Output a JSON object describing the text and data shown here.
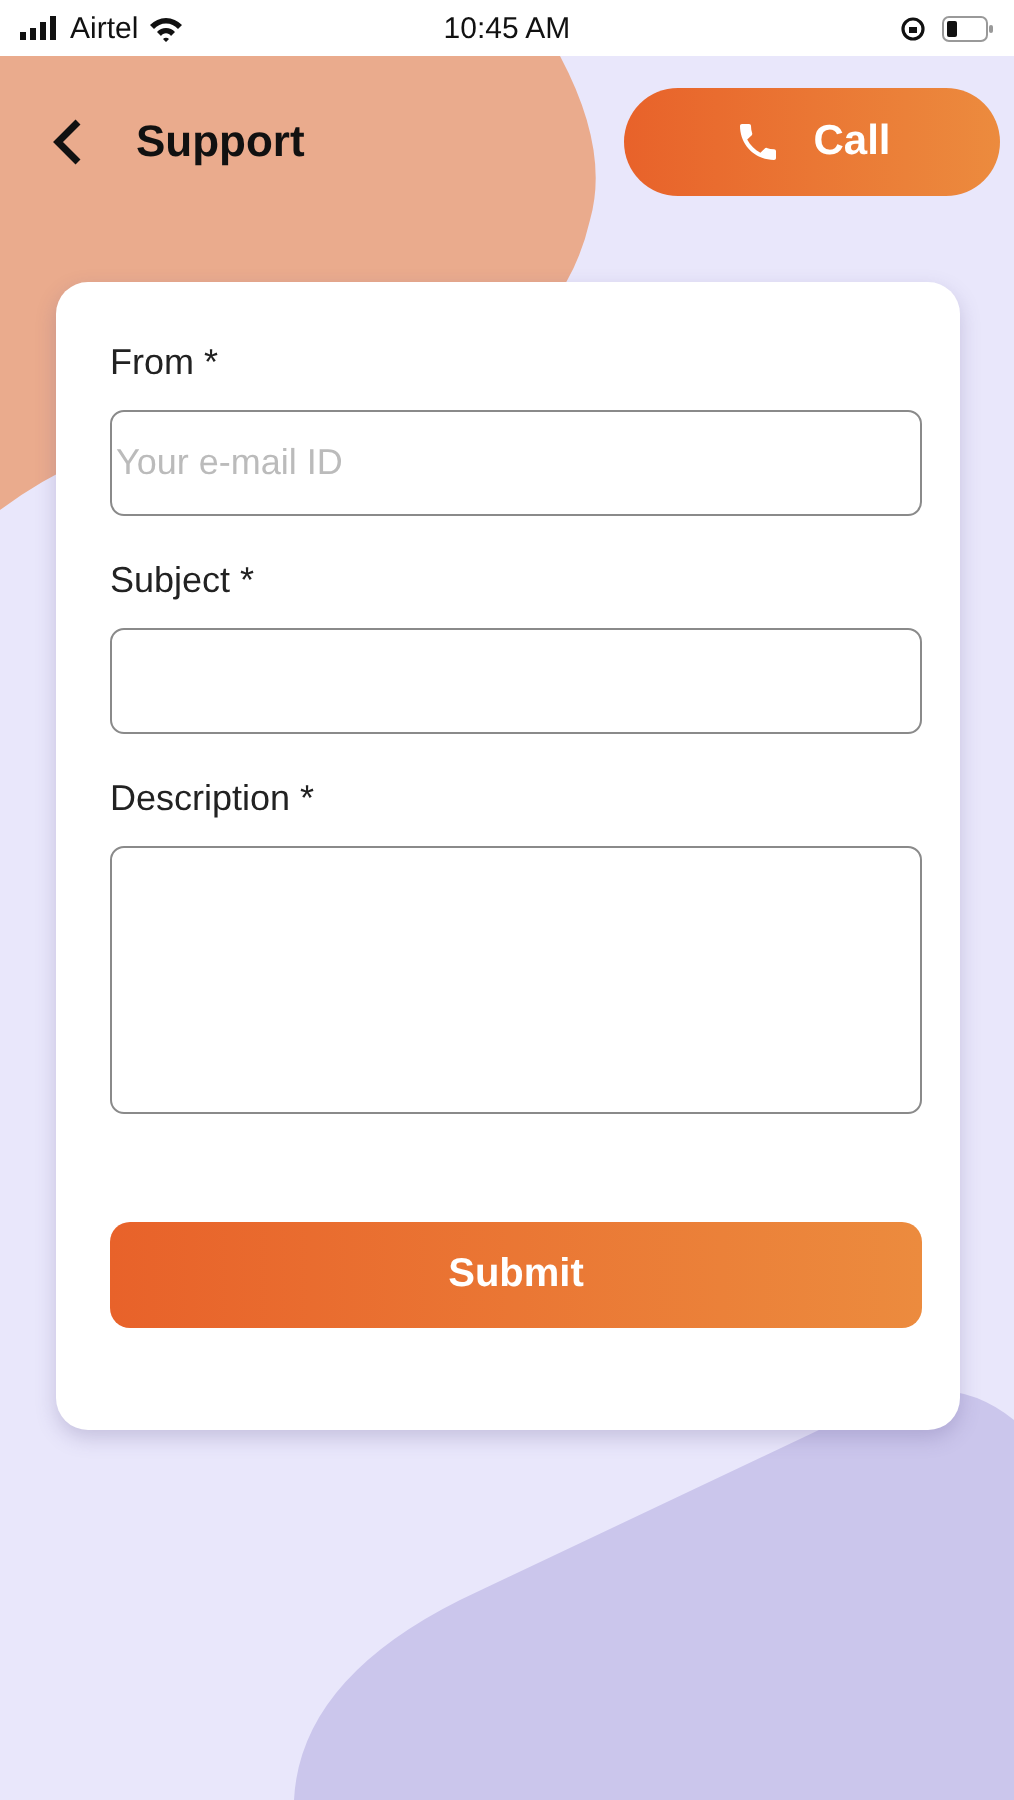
{
  "status_bar": {
    "carrier": "Airtel",
    "time": "10:45 AM"
  },
  "header": {
    "title": "Support",
    "call_button": "Call"
  },
  "form": {
    "fields": [
      {
        "kind": "input",
        "label": "From *",
        "placeholder": "Your e-mail ID"
      },
      {
        "kind": "input",
        "label": "Subject *"
      },
      {
        "kind": "textarea",
        "label": "Description *"
      }
    ],
    "submit": "Submit"
  }
}
